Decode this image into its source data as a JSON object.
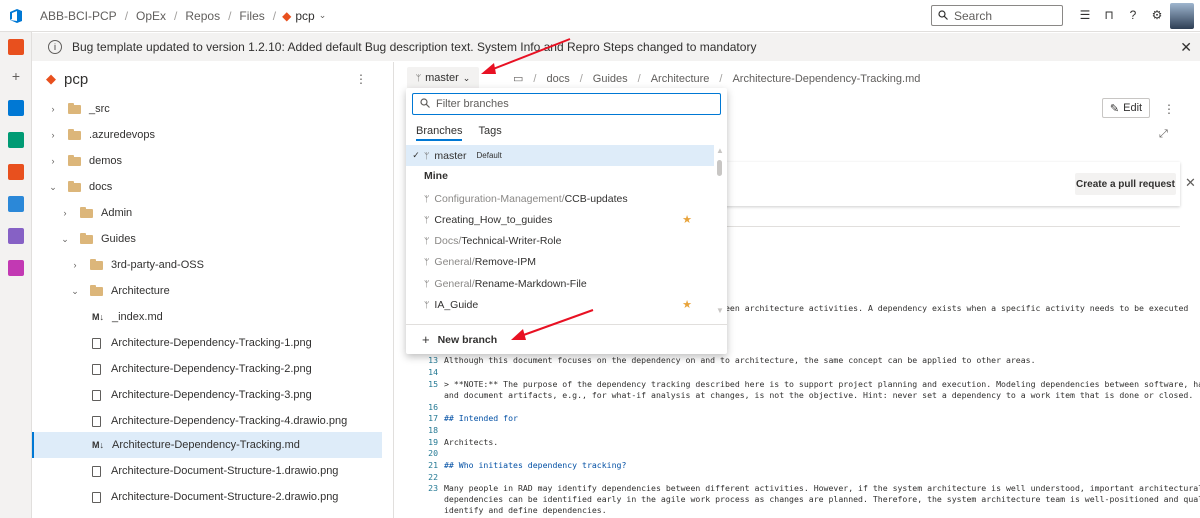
{
  "topbar": {
    "breadcrumb": [
      "ABB-BCI-PCP",
      "OpEx",
      "Repos",
      "Files"
    ],
    "repo": "pcp",
    "search_placeholder": "Search"
  },
  "banner": {
    "text": "Bug template updated to version 1.2.10: Added default Bug description text. System Info and Repro Steps changed to mandatory"
  },
  "tree": {
    "repo_name": "pcp",
    "more": "⋮",
    "nodes": [
      {
        "label": "_src"
      },
      {
        "label": ".azuredevops"
      },
      {
        "label": "demos"
      },
      {
        "label": "docs"
      },
      {
        "label": "Admin"
      },
      {
        "label": "Guides"
      },
      {
        "label": "3rd-party-and-OSS"
      },
      {
        "label": "Architecture"
      },
      {
        "label": "_index.md"
      },
      {
        "label": "Architecture-Dependency-Tracking-1.png"
      },
      {
        "label": "Architecture-Dependency-Tracking-2.png"
      },
      {
        "label": "Architecture-Dependency-Tracking-3.png"
      },
      {
        "label": "Architecture-Dependency-Tracking-4.drawio.png"
      },
      {
        "label": "Architecture-Dependency-Tracking.md"
      },
      {
        "label": "Architecture-Document-Structure-1.drawio.png"
      },
      {
        "label": "Architecture-Document-Structure-2.drawio.png"
      }
    ]
  },
  "main": {
    "branch": "master",
    "path": [
      "docs",
      "Guides",
      "Architecture",
      "Architecture-Dependency-Tracking.md"
    ],
    "edit_label": "Edit",
    "pr_label": "Create a pull request",
    "code_lines": [
      {
        "ln": "",
        "text": "een architecture activities. A dependency exists when a specific activity needs to be executed"
      },
      {
        "ln": "13",
        "text": "Although this document focuses on the dependency on and to architecture, the same concept can be applied to other areas."
      },
      {
        "ln": "14",
        "text": ""
      },
      {
        "ln": "15",
        "text": "> **NOTE:** The purpose of the dependency tracking described here is to support project planning and execution. Modeling dependencies between software, hardware,"
      },
      {
        "ln": "",
        "text": "and document artifacts, e.g., for what-if analysis at changes, is not the objective. Hint: never set a dependency to a work item that is done or closed."
      },
      {
        "ln": "16",
        "text": ""
      },
      {
        "ln": "17",
        "text": "## Intended for"
      },
      {
        "ln": "18",
        "text": ""
      },
      {
        "ln": "19",
        "text": "Architects."
      },
      {
        "ln": "20",
        "text": ""
      },
      {
        "ln": "21",
        "text": "## Who initiates dependency tracking?"
      },
      {
        "ln": "22",
        "text": ""
      },
      {
        "ln": "23",
        "text": "Many people in RAD may identify dependencies between different activities. However, if the system architecture is well understood, important architectural"
      },
      {
        "ln": "",
        "text": "dependencies can be identified early in the agile work process as changes are planned. Therefore, the system architecture team is well-positioned and qualified to"
      },
      {
        "ln": "",
        "text": "identify and define dependencies."
      },
      {
        "ln": "24",
        "text": ""
      }
    ]
  },
  "dropdown": {
    "filter_placeholder": "Filter branches",
    "tab_branches": "Branches",
    "tab_tags": "Tags",
    "default_branch": "master",
    "default_badge": "Default",
    "mine_header": "Mine",
    "branches": [
      {
        "prefix": "Configuration-Management/",
        "name": "CCB-updates",
        "star": false
      },
      {
        "prefix": "",
        "name": "Creating_How_to_guides",
        "star": true
      },
      {
        "prefix": "Docs/",
        "name": "Technical-Writer-Role",
        "star": false
      },
      {
        "prefix": "General/",
        "name": "Remove-IPM",
        "star": false
      },
      {
        "prefix": "General/",
        "name": "Rename-Markdown-File",
        "star": false
      },
      {
        "prefix": "",
        "name": "IA_Guide",
        "star": true
      }
    ],
    "new_branch": "New branch"
  },
  "colors": {
    "accent": "#0078d4",
    "annotation_arrow": "#e81123",
    "star": "#e8a33a"
  }
}
